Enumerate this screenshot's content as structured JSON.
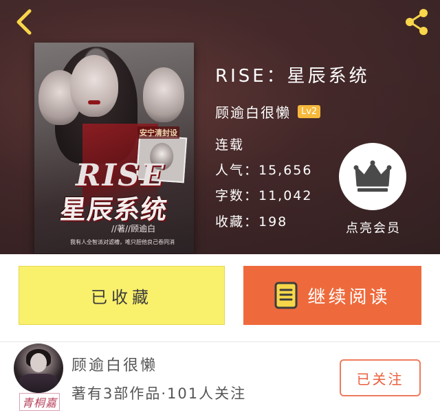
{
  "header": {
    "back_icon": "chevron-left-icon",
    "share_icon": "share-icon",
    "accent_color": "#f9d64a"
  },
  "book": {
    "title": "RISE：星辰系统",
    "author": "顾逾白很懒",
    "level": "Lv2",
    "status": "连载",
    "popularity": "人气：15,656",
    "word_count": "字数：11,042",
    "favorites": "收藏：198"
  },
  "cover": {
    "tag": "安宁清封设",
    "title_en": "RISE",
    "title_cn": "星辰系统",
    "author_line": "//著//顾逾白",
    "blurb": "我有人全智派对滤槽，唯只胆他良己卷同消"
  },
  "vip": {
    "icon": "crown-icon",
    "label": "点亮会员"
  },
  "actions": {
    "collect_label": "已收藏",
    "read_label": "继续阅读",
    "read_icon": "book-icon",
    "collect_color": "#f9f06c",
    "read_color": "#ee6a3c"
  },
  "author_card": {
    "name": "顾逾白很懒",
    "works": "著有3部作品·101人关注",
    "avatar_signature": "青桐嘉",
    "follow_label": "已关注",
    "follow_color": "#ea5f3d"
  }
}
